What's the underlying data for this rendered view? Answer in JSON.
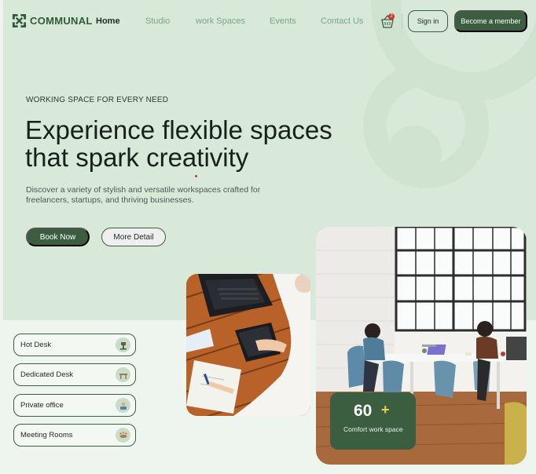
{
  "brand": {
    "name": "COMMUNAL",
    "color": "#3b5e41"
  },
  "nav": {
    "links": [
      "Home",
      "Studio",
      "work Spaces",
      "Events",
      "Contact Us"
    ],
    "cart_count": "2",
    "signin_label": "Sign in",
    "member_label": "Become a member"
  },
  "hero": {
    "eyebrow": "WORKING SPACE FOR EVERY NEED",
    "headline_line1": "Experience flexible spaces",
    "headline_line2": "that spark creativity",
    "description": "Discover a variety of stylish and versatile workspaces crafted for freelancers, startups, and thriving businesses.",
    "book_label": "Book Now",
    "more_label": "More Detail"
  },
  "categories": [
    {
      "label": "Hot Desk",
      "icon": "desk-lamp-icon"
    },
    {
      "label": "Dedicated Desk",
      "icon": "desk-icon"
    },
    {
      "label": "Private office",
      "icon": "office-icon"
    },
    {
      "label": "Meeting Rooms",
      "icon": "meeting-icon"
    }
  ],
  "stat": {
    "number": "60",
    "plus": "+",
    "label": "Comfort work space"
  },
  "images": {
    "laptop_photo": "person-working-on-laptop-photo",
    "office_photo": "coworking-office-photo"
  }
}
